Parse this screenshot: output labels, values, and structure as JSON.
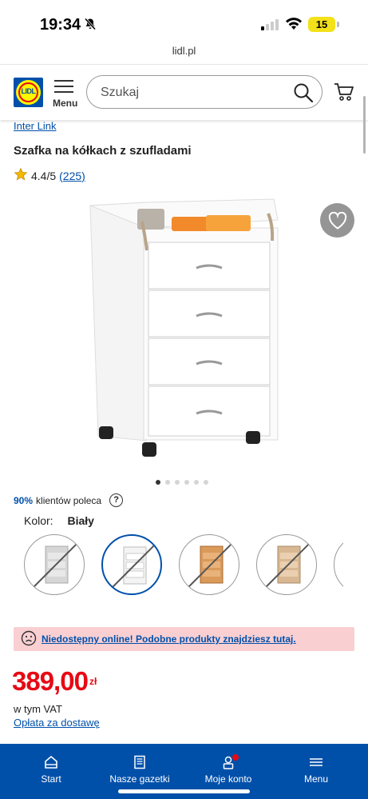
{
  "status_bar": {
    "time": "19:34",
    "battery": "15"
  },
  "browser": {
    "url": "lidl.pl"
  },
  "header": {
    "logo_text": "LIDL",
    "menu_label": "Menu",
    "search_placeholder": "Szukaj"
  },
  "product": {
    "brand": "Inter Link",
    "title": "Szafka na kółkach z szufladami",
    "rating": "4.4/5",
    "rating_count": "(225)",
    "image_count": 6,
    "active_image": 1,
    "recommend_percent": "90%",
    "recommend_text": "klientów poleca",
    "recommend_help": "?",
    "color_label": "Kolor:",
    "color_value": "Biały",
    "swatches": [
      {
        "name": "szary",
        "color": "#c8c8c8",
        "selected": false
      },
      {
        "name": "biały",
        "color": "#eeeeee",
        "selected": true
      },
      {
        "name": "buk",
        "color": "#d9a066",
        "selected": false
      },
      {
        "name": "klon",
        "color": "#d8bc98",
        "selected": false
      },
      {
        "name": "partial",
        "color": "#f2f2f2",
        "selected": false
      }
    ],
    "notice": "Niedostępny online! Podobne produkty znajdziesz tutaj.",
    "price": "389,00",
    "currency": "zł",
    "vat_text": "w tym VAT",
    "shipping_link": "Opłata za dostawę"
  },
  "bottom_nav": {
    "items": [
      {
        "label": "Start",
        "icon": "home-icon"
      },
      {
        "label": "Nasze gazetki",
        "icon": "newspaper-icon"
      },
      {
        "label": "Moje konto",
        "icon": "account-icon"
      },
      {
        "label": "Menu",
        "icon": "menu-icon"
      }
    ]
  },
  "colors": {
    "lidl_blue": "#0050aa",
    "lidl_red": "#e60a14",
    "lidl_yellow": "#fff500",
    "notice_bg": "#f9cfd2"
  }
}
